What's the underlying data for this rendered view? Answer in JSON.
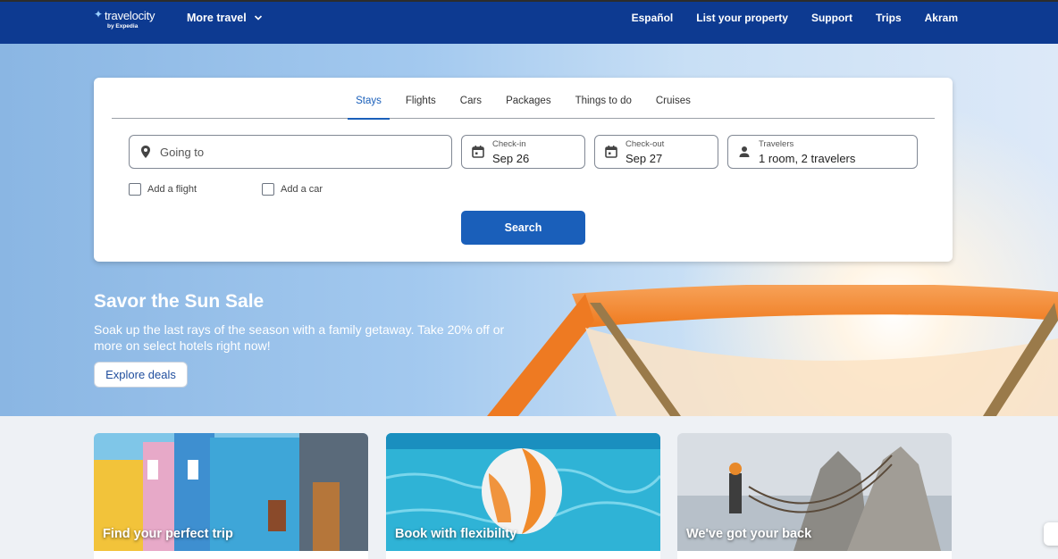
{
  "header": {
    "logo_text": "travelocity",
    "logo_byline": "by Expedia",
    "more_travel": "More travel",
    "links": [
      "Español",
      "List your property",
      "Support",
      "Trips",
      "Akram"
    ],
    "bg_color": "#0d3a91"
  },
  "search": {
    "tabs": [
      "Stays",
      "Flights",
      "Cars",
      "Packages",
      "Things to do",
      "Cruises"
    ],
    "active_tab": "Stays",
    "destination_placeholder": "Going to",
    "checkin_label": "Check-in",
    "checkin_value": "Sep 26",
    "checkout_label": "Check-out",
    "checkout_value": "Sep 27",
    "travelers_label": "Travelers",
    "travelers_value": "1 room, 2 travelers",
    "add_flight": "Add a flight",
    "add_car": "Add a car",
    "search_button": "Search",
    "accent_color": "#1a5fba"
  },
  "hero": {
    "title": "Savor the Sun Sale",
    "subtitle": "Soak up the last rays of the season with a family getaway. Take 20% off or more on select hotels right now!",
    "cta": "Explore deals"
  },
  "promos": [
    {
      "label": "Find your perfect trip"
    },
    {
      "label": "Book with flexibility"
    },
    {
      "label": "We've got your back"
    }
  ]
}
